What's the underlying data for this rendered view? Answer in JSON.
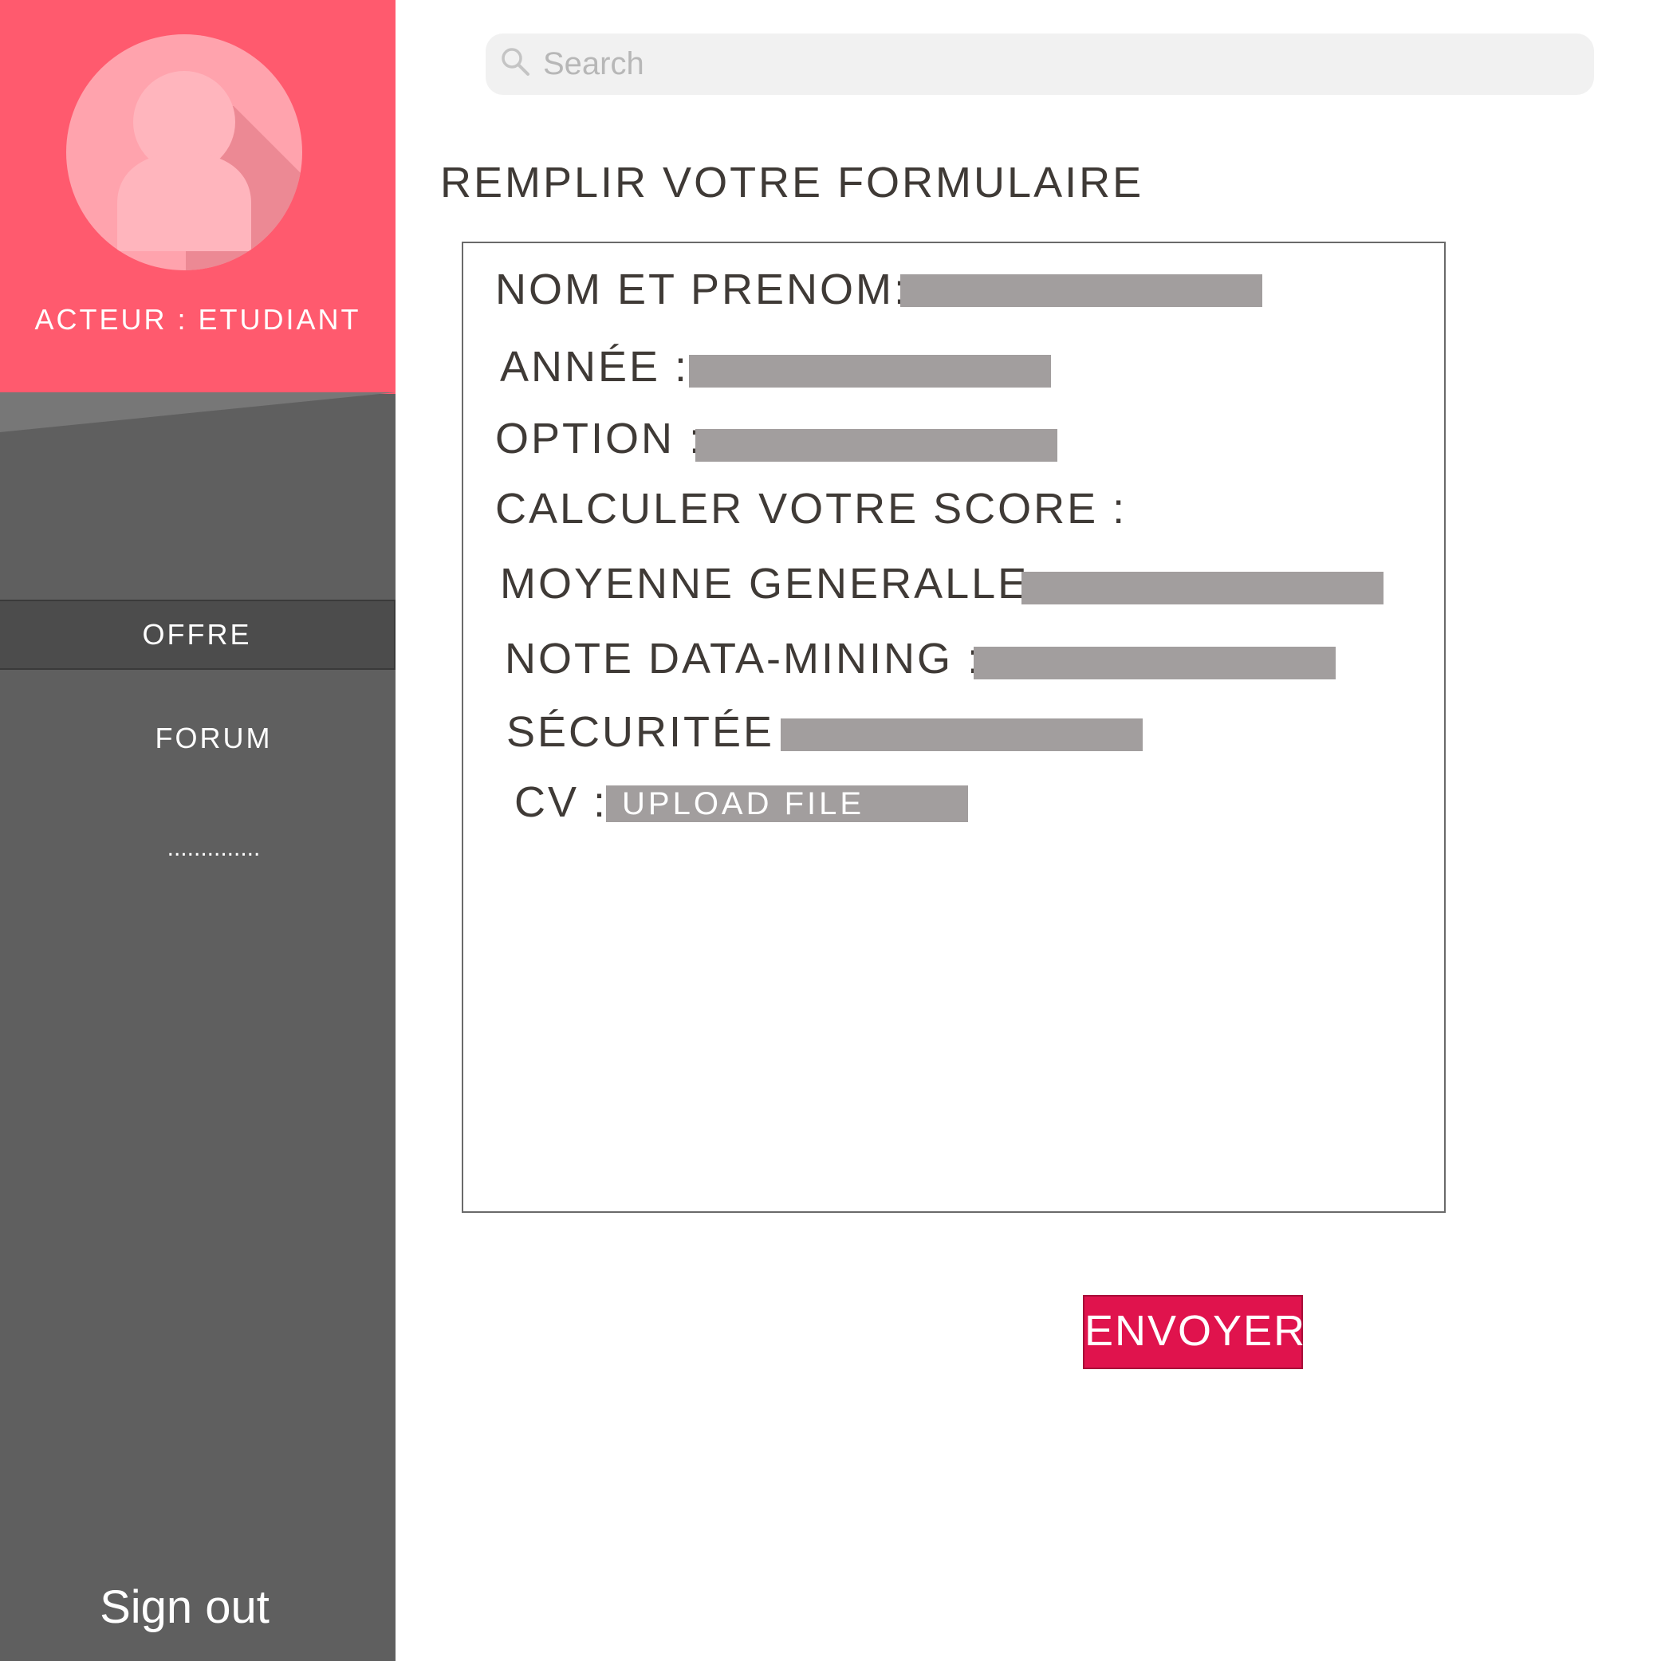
{
  "sidebar": {
    "actor_label": "ACTEUR : ETUDIANT",
    "nav": [
      {
        "label": "OFFRE",
        "active": true
      },
      {
        "label": "FORUM",
        "active": false
      },
      {
        "label": "..............",
        "active": false
      }
    ],
    "signout_label": "Sign out"
  },
  "search": {
    "placeholder": "Search",
    "value": ""
  },
  "page_title": "REMPLIR VOTRE FORMULAIRE",
  "form": {
    "fields": [
      {
        "label": "NOM ET PRENOM:",
        "value": ""
      },
      {
        "label": "ANNÉE :",
        "value": ""
      },
      {
        "label": "OPTION :",
        "value": ""
      },
      {
        "label": "CALCULER VOTRE SCORE :"
      },
      {
        "label": "MOYENNE GENERALLE :",
        "value": ""
      },
      {
        "label": "NOTE DATA-MINING :",
        "value": ""
      },
      {
        "label": "SÉCURITÉE :",
        "value": ""
      },
      {
        "label": "CV :"
      }
    ],
    "upload_label": "UPLOAD  FILE"
  },
  "submit_label": "ENVOYER",
  "colors": {
    "profile_bg": "#ff5a6e",
    "sidebar_bg": "#5f5f5f",
    "active_nav_bg": "#4c4c4c",
    "field_fill": "#a29e9e",
    "accent": "#e0134d",
    "text": "#3f3a36"
  }
}
